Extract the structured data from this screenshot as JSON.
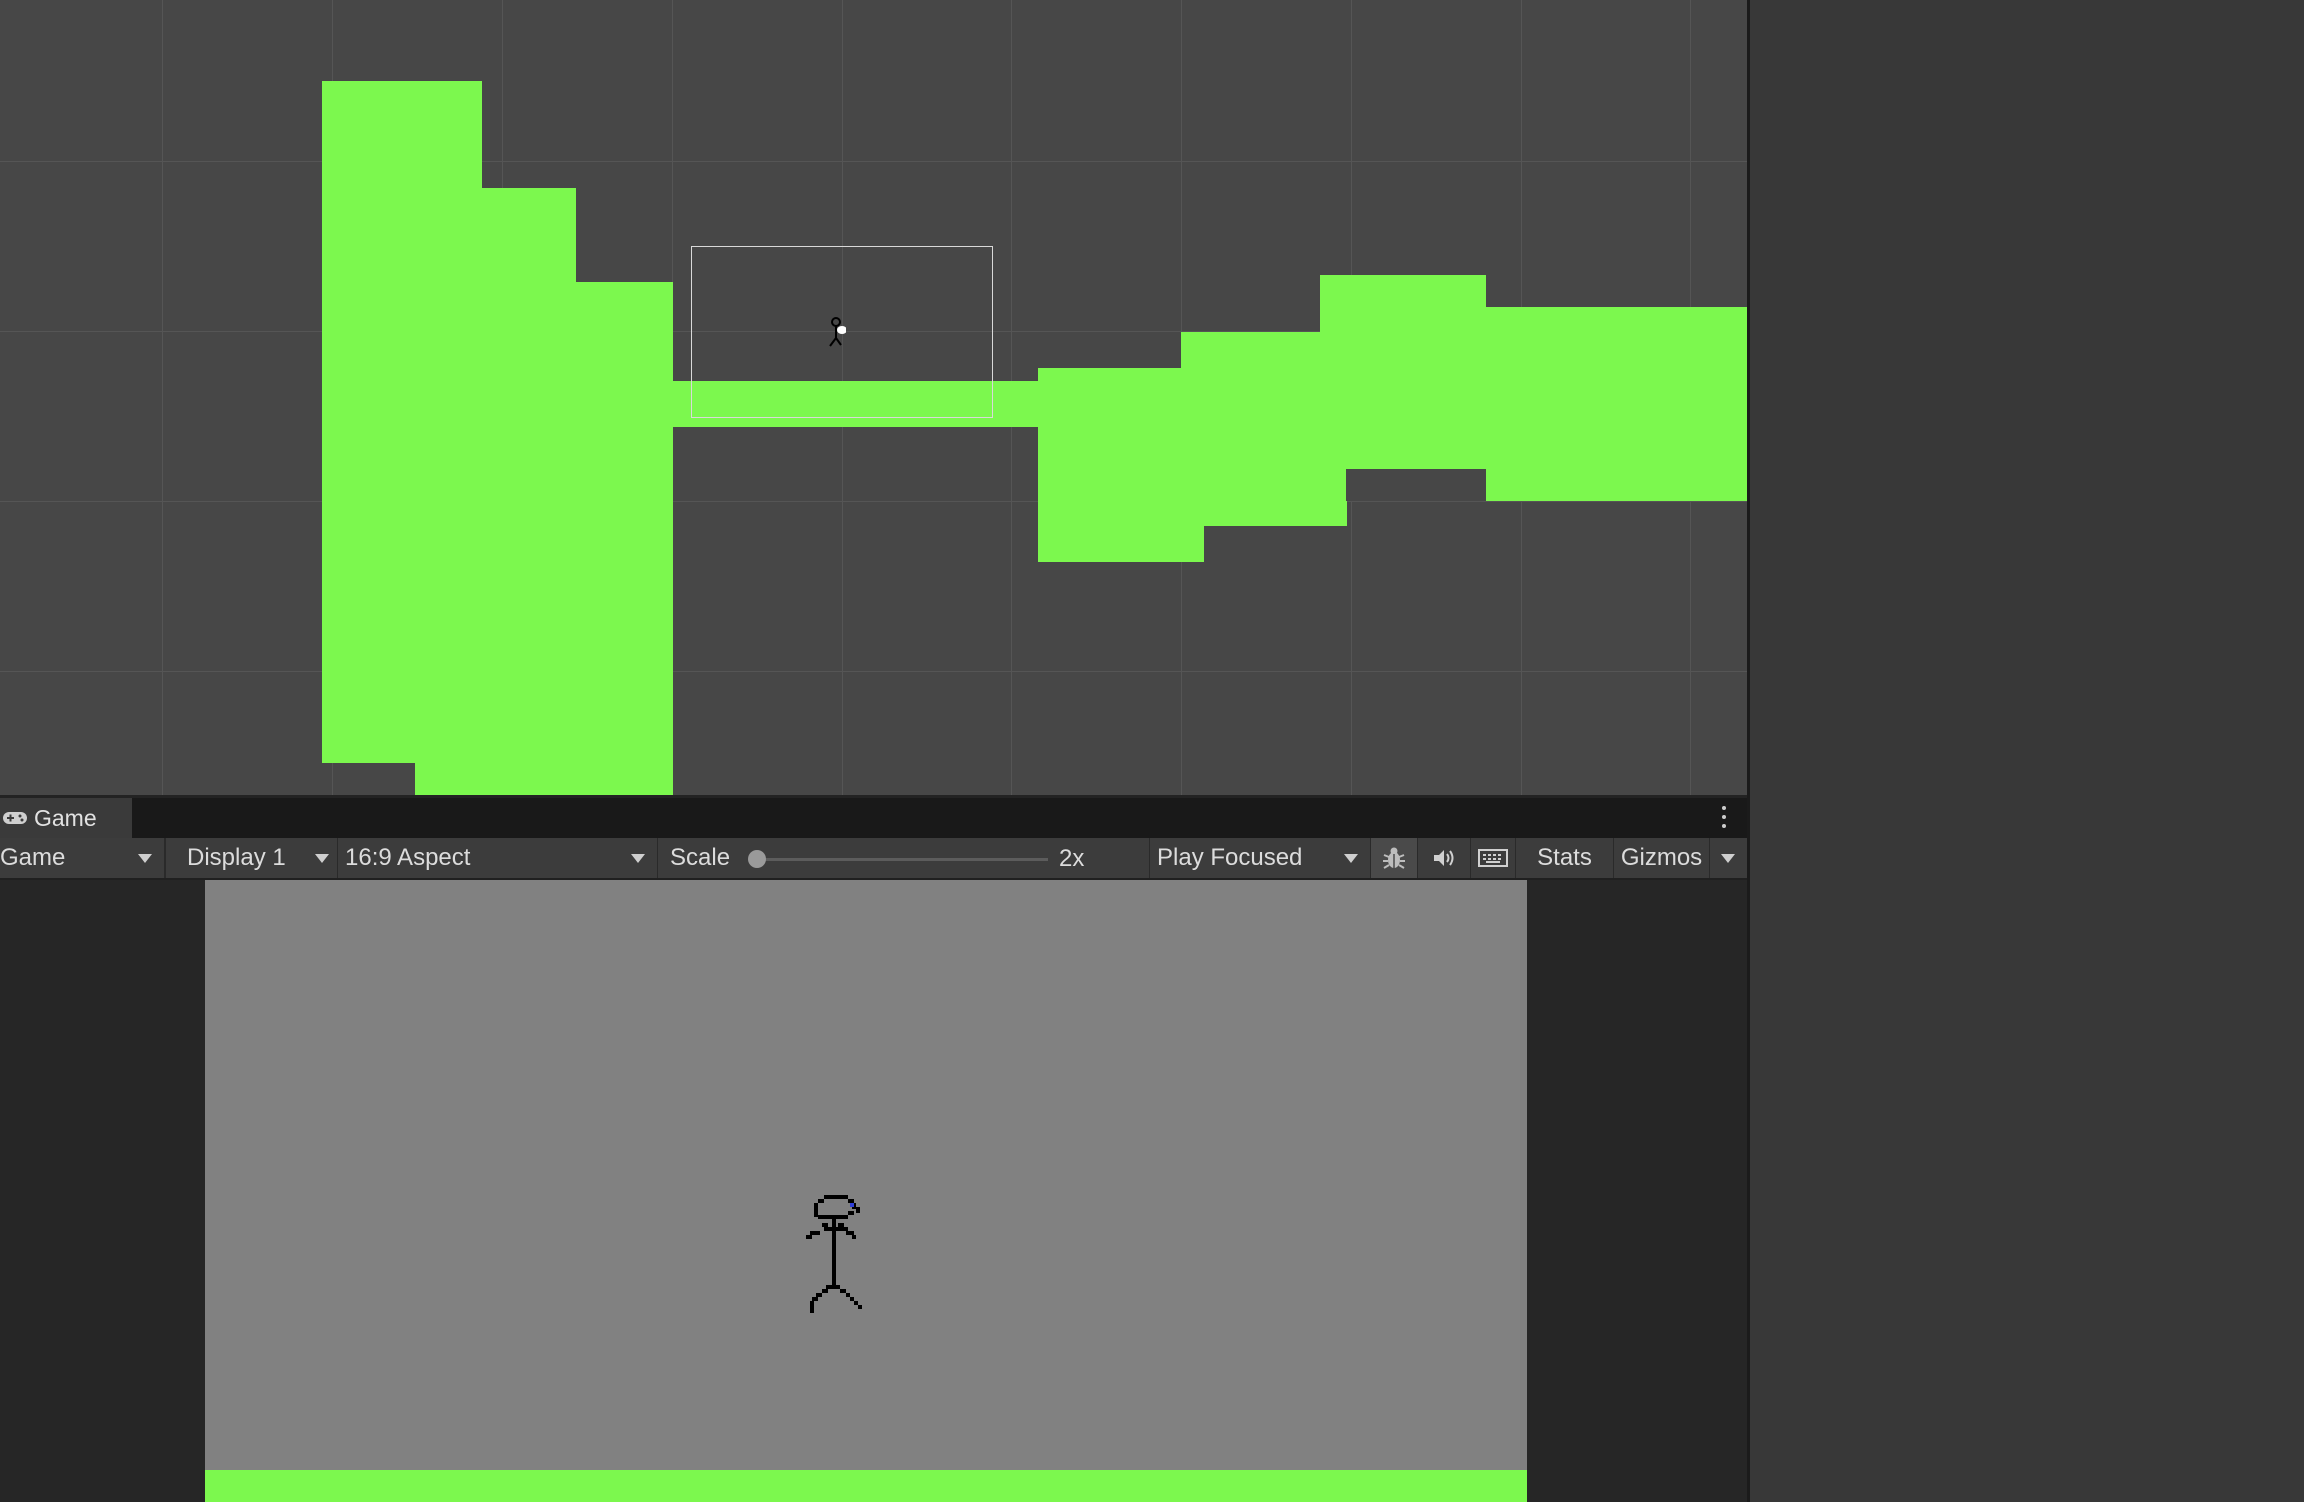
{
  "scene_view": {
    "background": "#474747",
    "terrain_color": "#7cf84e"
  },
  "game_window": {
    "tab_label": "Game",
    "tab_icon": "gamepad-icon",
    "menu_icon": "kebab-menu-icon"
  },
  "toolbar": {
    "view_dropdown": "Game",
    "display_dropdown": "Display 1",
    "aspect_dropdown": "16:9 Aspect",
    "scale_label": "Scale",
    "scale_value": "2x",
    "scale_level": 0.0,
    "play_mode_dropdown": "Play Focused",
    "bug_icon": "bug-icon",
    "audio_icon": "speaker-icon",
    "keyboard_icon": "keyboard-icon",
    "stats_button": "Stats",
    "gizmos_button": "Gizmos"
  },
  "game_view": {
    "background": "#818181",
    "ground_color": "#7cf84e",
    "player_eye_color": "#2f3fd8"
  }
}
